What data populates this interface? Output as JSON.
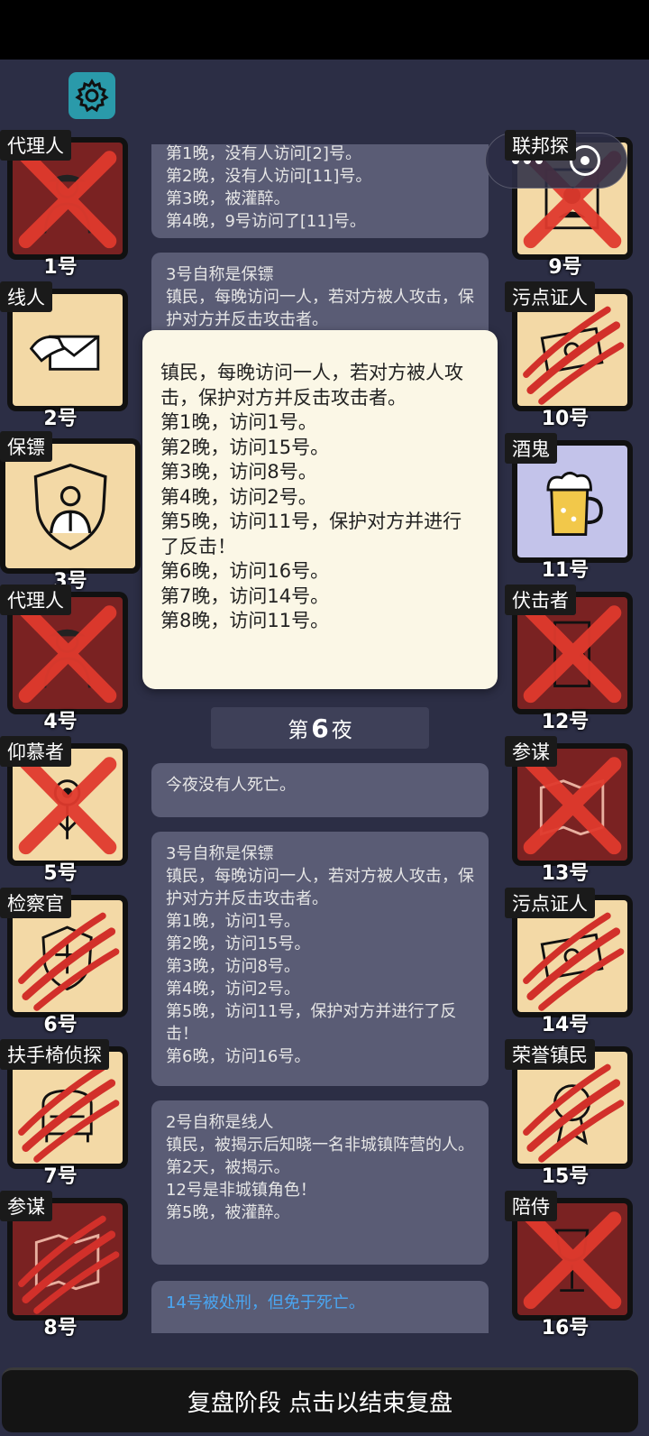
{
  "header": {
    "settings_icon": "gear-icon"
  },
  "capsule": {
    "more_icon": "more-dots-icon",
    "close_icon": "target-icon"
  },
  "players": [
    {
      "num": "1号",
      "role": "代理人",
      "state": "dead-x",
      "bg": "red",
      "icon": "spy-icon"
    },
    {
      "num": "2号",
      "role": "线人",
      "state": "alive",
      "bg": "tan",
      "icon": "envelope-hand-icon"
    },
    {
      "num": "3号",
      "role": "保镖",
      "state": "alive",
      "bg": "tan",
      "icon": "bodyguard-shield-icon"
    },
    {
      "num": "4号",
      "role": "代理人",
      "state": "dead-x",
      "bg": "red",
      "icon": "spy-icon"
    },
    {
      "num": "5号",
      "role": "仰慕者",
      "state": "dead-x",
      "bg": "tan",
      "icon": "flower-icon"
    },
    {
      "num": "6号",
      "role": "检察官",
      "state": "claw",
      "bg": "tan",
      "icon": "emblem-icon"
    },
    {
      "num": "7号",
      "role": "扶手椅侦探",
      "state": "claw",
      "bg": "tan",
      "icon": "armchair-icon"
    },
    {
      "num": "8号",
      "role": "参谋",
      "state": "claw",
      "bg": "red",
      "icon": "map-icon"
    },
    {
      "num": "9号",
      "role": "联邦探",
      "state": "dead-x",
      "bg": "tan",
      "icon": "badge-icon"
    },
    {
      "num": "10号",
      "role": "污点证人",
      "state": "claw",
      "bg": "tan",
      "icon": "money-icon"
    },
    {
      "num": "11号",
      "role": "酒鬼",
      "state": "alive",
      "bg": "lav",
      "icon": "beer-mug-icon"
    },
    {
      "num": "12号",
      "role": "伏击者",
      "state": "dead-x",
      "bg": "red",
      "icon": "door-icon"
    },
    {
      "num": "13号",
      "role": "参谋",
      "state": "dead-x",
      "bg": "red",
      "icon": "map-icon"
    },
    {
      "num": "14号",
      "role": "污点证人",
      "state": "claw",
      "bg": "tan",
      "icon": "money-icon"
    },
    {
      "num": "15号",
      "role": "荣誉镇民",
      "state": "claw",
      "bg": "tan",
      "icon": "medal-icon"
    },
    {
      "num": "16号",
      "role": "陪侍",
      "state": "dead-x",
      "bg": "red",
      "icon": "wine-glass-icon"
    }
  ],
  "log": {
    "msg1": "第1晚，没有人访问[2]号。\n第2晚，没有人访问[11]号。\n第3晚，被灌醉。\n第4晚，9号访问了[11]号。",
    "msg2": "3号自称是保镖\n镇民，每晚访问一人，若对方被人攻击，保护对方并反击攻击者。",
    "night_prefix": "第",
    "night_num": "6",
    "night_suffix": "夜",
    "msg3": "今夜没有人死亡。",
    "msg4": "3号自称是保镖\n镇民，每晚访问一人，若对方被人攻击，保护对方并反击攻击者。\n第1晚，访问1号。\n第2晚，访问15号。\n第3晚，访问8号。\n第4晚，访问2号。\n第5晚，访问11号，保护对方并进行了反击！\n第6晚，访问16号。",
    "msg5": "2号自称是线人\n镇民，被揭示后知晓一名非城镇阵营的人。\n第2天，被揭示。\n12号是非城镇角色！\n第5晚，被灌醉。",
    "msg6": "14号被处刑，但免于死亡。"
  },
  "popup": {
    "text": "镇民，每晚访问一人，若对方被人攻击，保护对方并反击攻击者。\n第1晚，访问1号。\n第2晚，访问15号。\n第3晚，访问8号。\n第4晚，访问2号。\n第5晚，访问11号，保护对方并进行了反击！\n第6晚，访问16号。\n第7晚，访问14号。\n第8晚，访问11号。"
  },
  "footer": {
    "label": "复盘阶段 点击以结束复盘"
  }
}
